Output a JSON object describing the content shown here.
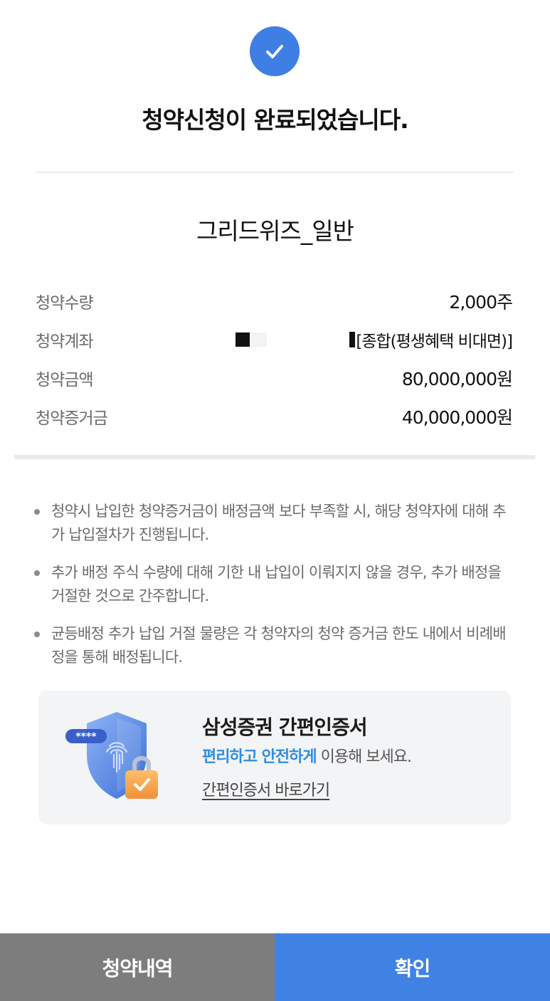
{
  "header": {
    "icon": "check-icon",
    "title": "청약신청이 완료되었습니다."
  },
  "product": {
    "name": "그리드위즈_일반"
  },
  "details": {
    "quantity_label": "청약수량",
    "quantity_value": "2,000주",
    "account_label": "청약계좌",
    "account_value": "[종합(평생혜택 비대면)]",
    "amount_label": "청약금액",
    "amount_value": "80,000,000원",
    "deposit_label": "청약증거금",
    "deposit_value": "40,000,000원"
  },
  "notes": [
    "청약시 납입한 청약증거금이 배정금액 보다 부족할 시, 해당 청약자에 대해 추가 납입절차가 진행됩니다.",
    "추가 배정 주식 수량에 대해 기한 내 납입이 이뤄지지 않을 경우, 추가 배정을 거절한 것으로 간주합니다.",
    "균등배정 추가 납입 거절 물량은 각 청약자의 청약 증거금 한도 내에서 비례배정을 통해 배정됩니다."
  ],
  "cert_banner": {
    "title": "삼성증권 간편인증서",
    "desc_accent": "편리하고 안전하게",
    "desc_rest": " 이용해 보세요.",
    "link": "간편인증서 바로가기",
    "password_mask": "****"
  },
  "buttons": {
    "history": "청약내역",
    "confirm": "확인"
  },
  "colors": {
    "accent_blue": "#3f82e4",
    "gray_button": "#7d7d7d",
    "link_blue": "#2f8de0"
  }
}
